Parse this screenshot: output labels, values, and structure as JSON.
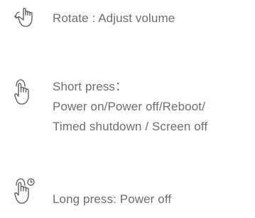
{
  "items": [
    {
      "icon": "rotate-hand-icon",
      "lines": [
        "Rotate : Adjust volume"
      ]
    },
    {
      "icon": "tap-hand-icon",
      "lines": [
        "Short press：",
        "Power on/Power off/Reboot/",
        "Timed shutdown / Screen off"
      ]
    },
    {
      "icon": "long-press-hand-icon",
      "lines": [
        "Long press: Power off"
      ]
    }
  ]
}
